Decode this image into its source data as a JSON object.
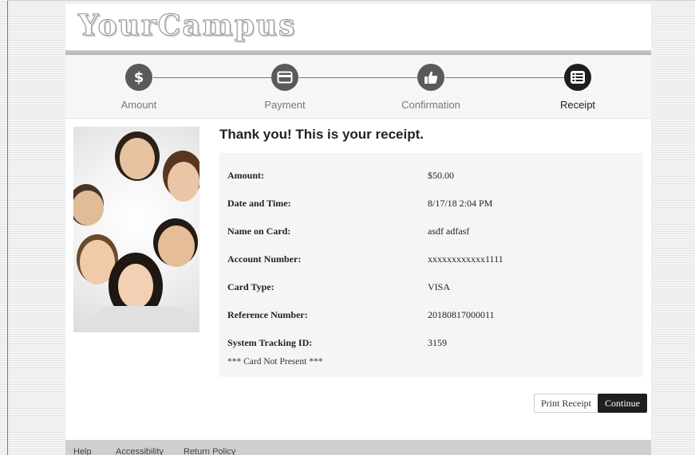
{
  "header": {
    "logo_text": "YourCampus"
  },
  "steps": [
    {
      "label": "Amount",
      "icon": "dollar-icon"
    },
    {
      "label": "Payment",
      "icon": "credit-card-icon"
    },
    {
      "label": "Confirmation",
      "icon": "thumbs-up-icon"
    },
    {
      "label": "Receipt",
      "icon": "list-icon",
      "active": true
    }
  ],
  "receipt": {
    "title": "Thank you! This is your receipt.",
    "rows": [
      {
        "label": "Amount:",
        "value": "$50.00"
      },
      {
        "label": "Date and Time:",
        "value": "8/17/18 2:04 PM"
      },
      {
        "label": "Name on Card:",
        "value": "asdf adfasf"
      },
      {
        "label": "Account Number:",
        "value": "xxxxxxxxxxxx1111"
      },
      {
        "label": "Card Type:",
        "value": "VISA"
      },
      {
        "label": "Reference Number:",
        "value": "20180817000011"
      },
      {
        "label": "System Tracking ID:",
        "value": "3159"
      }
    ],
    "note": "*** Card Not Present ***"
  },
  "buttons": {
    "print": "Print Receipt",
    "continue": "Continue"
  },
  "footer": {
    "links": [
      "Help",
      "Accessibility",
      "Return Policy"
    ]
  },
  "colors": {
    "active_step": "#1e1e1e",
    "inactive_step": "#5a5a5a",
    "continue_bg": "#1f1f1f",
    "panel_bg": "#f5f5f5"
  }
}
